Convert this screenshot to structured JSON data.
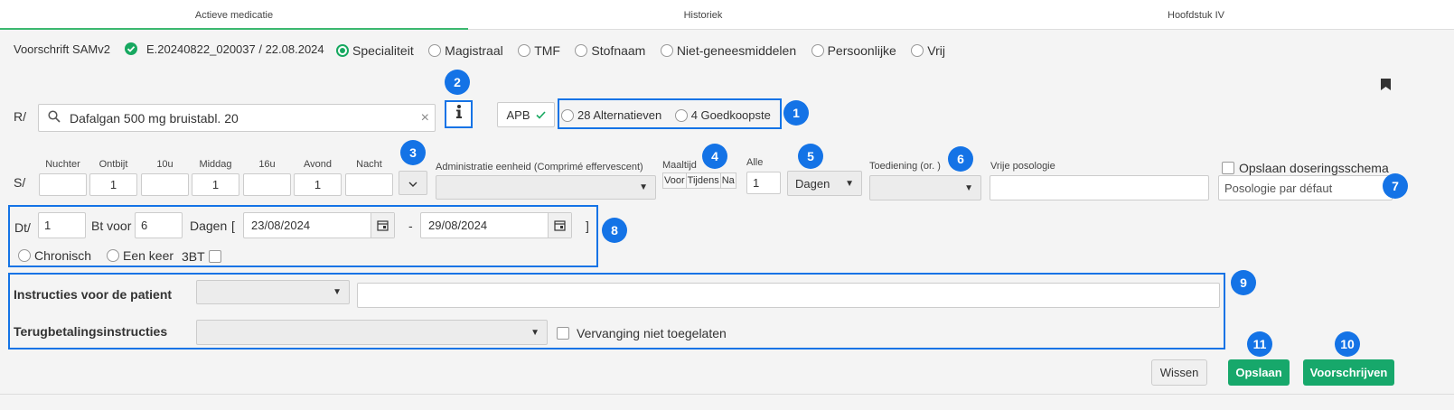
{
  "tabs": [
    "Actieve medicatie",
    "Historiek",
    "Hoofdstuk IV"
  ],
  "header": {
    "title": "Voorschrift SAMv2",
    "prescription_id": "E.20240822_020037 / 22.08.2024",
    "types": [
      "Specialiteit",
      "Magistraal",
      "TMF",
      "Stofnaam",
      "Niet-geneesmiddelen",
      "Persoonlijke",
      "Vrij"
    ],
    "selected_type": "Specialiteit"
  },
  "r": {
    "label": "R/",
    "search_value": "Dafalgan 500 mg bruistabl. 20",
    "apb_label": "APB",
    "alternatives_label": "28 Alternatieven",
    "cheapest_label": "4 Goedkoopste"
  },
  "s": {
    "label": "S/",
    "times": [
      {
        "label": "Nuchter",
        "value": ""
      },
      {
        "label": "Ontbijt",
        "value": "1"
      },
      {
        "label": "10u",
        "value": ""
      },
      {
        "label": "Middag",
        "value": "1"
      },
      {
        "label": "16u",
        "value": ""
      },
      {
        "label": "Avond",
        "value": "1"
      },
      {
        "label": "Nacht",
        "value": ""
      }
    ],
    "admin_unit_label": "Administratie eenheid (Comprimé effervescent)",
    "admin_unit_value": "",
    "meal_label": "Maaltijd",
    "meal_options": [
      "Voor",
      "Tijdens",
      "Na"
    ],
    "every_label": "Alle",
    "every_value": "1",
    "unit_value": "Dagen",
    "route_label": "Toediening (or. )",
    "route_value": "",
    "free_posology_label": "Vrije posologie",
    "free_posology_value": "",
    "save_schema_label": "Opslaan doseringsschema",
    "default_posology_placeholder": "Posologie par défaut"
  },
  "dt": {
    "label": "Dt/",
    "qty": "1",
    "bt_voor_label": "Bt voor",
    "days": "6",
    "days_label": "Dagen",
    "bracket_open": "[",
    "start_date": "23/08/2024",
    "dash": "-",
    "end_date": "29/08/2024",
    "bracket_close": "]",
    "chronisch_label": "Chronisch",
    "een_keer_label": "Een keer",
    "bt3_label": "3BT"
  },
  "instructions": {
    "patient_label": "Instructies voor de patient",
    "patient_select_value": "",
    "patient_text_value": "",
    "reimbursement_label": "Terugbetalingsinstructies",
    "reimbursement_value": "",
    "substitution_label": "Vervanging niet toegelaten"
  },
  "buttons": {
    "wissen": "Wissen",
    "opslaan": "Opslaan",
    "voorschrijven": "Voorschrijven"
  },
  "badges": [
    "1",
    "2",
    "3",
    "4",
    "5",
    "6",
    "7",
    "8",
    "9",
    "10",
    "11"
  ],
  "colors": {
    "accent_green": "#17a86b",
    "annotation_blue": "#1473e6"
  },
  "icons": {
    "check": "check-circle-icon",
    "search": "search-icon",
    "clear": "clear-icon",
    "info": "info-icon",
    "bookmark": "bookmark-icon",
    "calendar": "calendar-icon",
    "chevron": "chevron-down-icon"
  }
}
